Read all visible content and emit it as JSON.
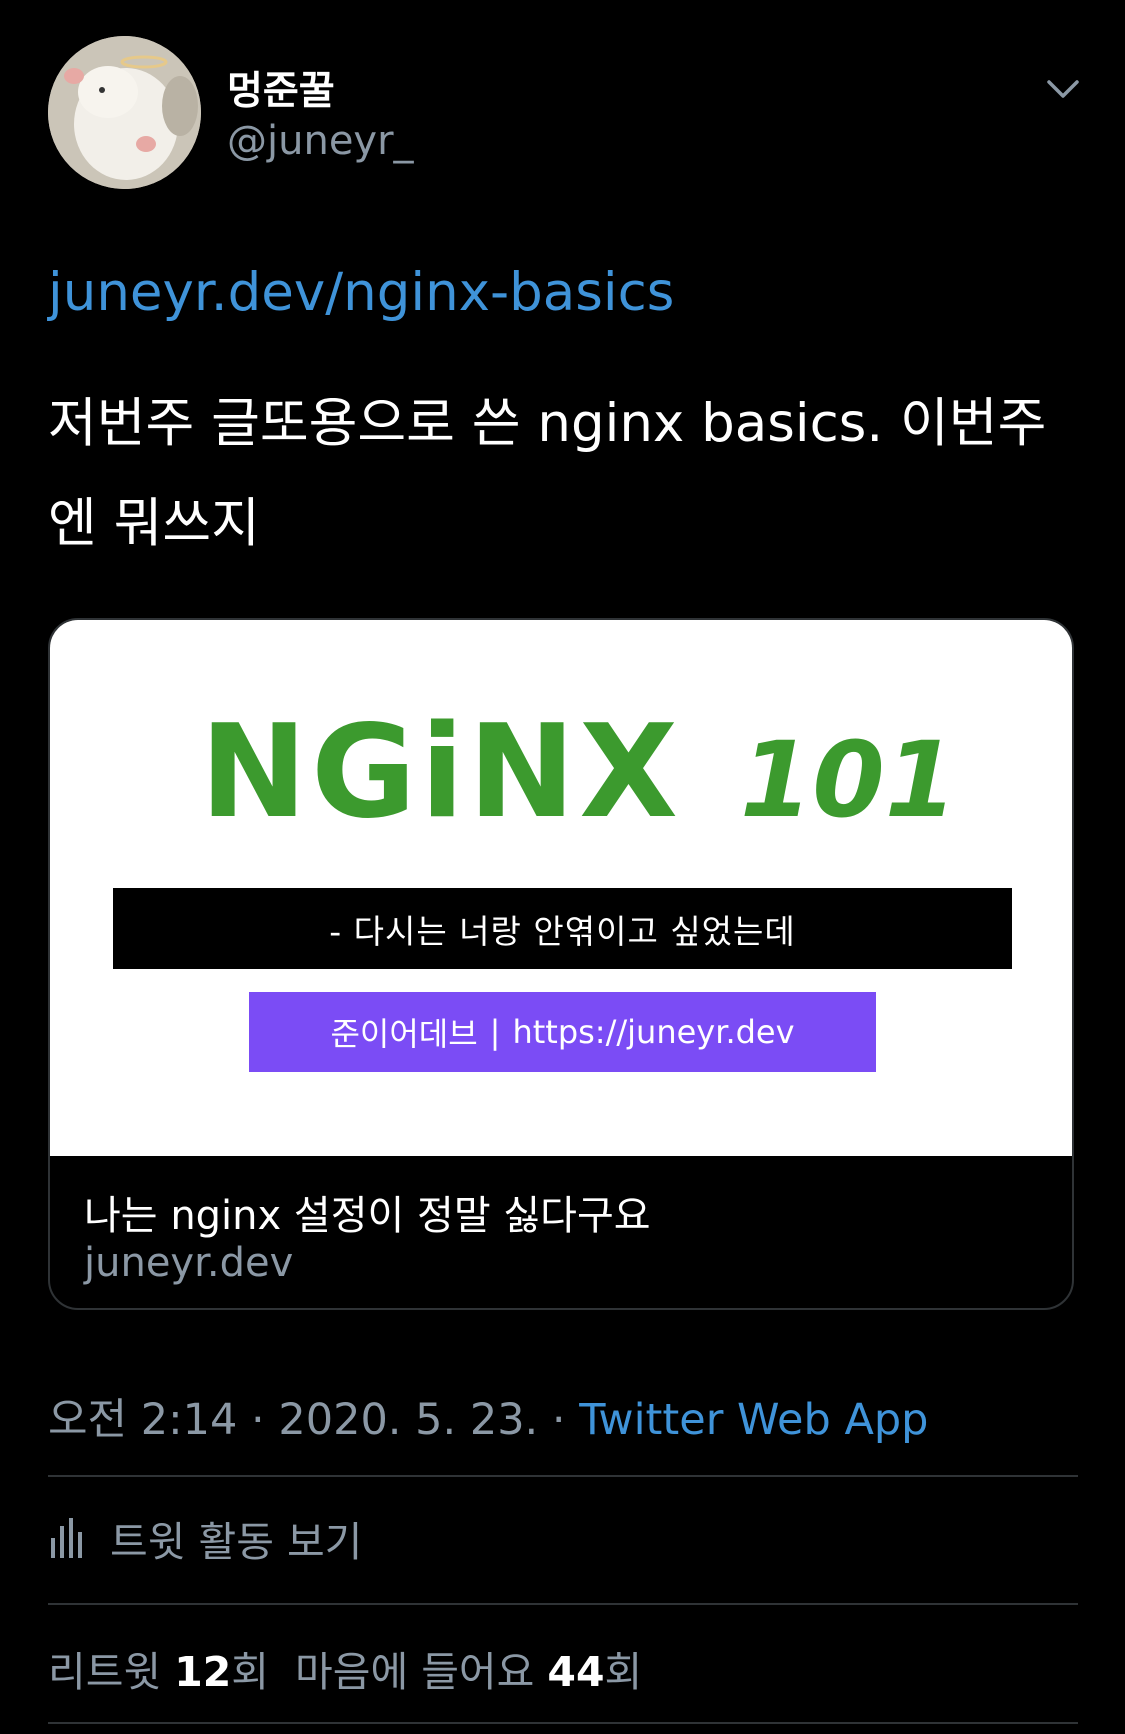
{
  "author": {
    "display_name": "멍준꿀",
    "handle": "@juneyr_"
  },
  "tweet": {
    "link": "juneyr.dev/nginx-basics",
    "text": "저번주 글또용으로 쓴 nginx basics. 이번주엔 뭐쓰지"
  },
  "card": {
    "image_logo_text": "NGiNX",
    "image_logo_number": "101",
    "image_subtitle": "- 다시는 너랑 안엮이고 싶었는데",
    "image_brand": "준이어데브",
    "image_separator": "|",
    "image_url": "https://juneyr.dev",
    "title": "나는 nginx 설정이 정말 싫다구요",
    "domain": "juneyr.dev"
  },
  "meta": {
    "time": "오전 2:14",
    "dot": "·",
    "date": "2020. 5. 23.",
    "source": "Twitter Web App"
  },
  "activity": {
    "label": "트윗 활동 보기"
  },
  "stats": {
    "retweets_label": "리트윗",
    "retweets_count": "12",
    "retweets_suffix": "회",
    "likes_label": "마음에 들어요",
    "likes_count": "44",
    "likes_suffix": "회"
  },
  "colors": {
    "background": "#000000",
    "link": "#3f93d9",
    "secondary_text": "#8b98a5",
    "divider": "#2f3336",
    "nginx_green": "#3c9a2e",
    "banner_purple": "#7b4cf5"
  },
  "icons": {
    "chevron": "chevron-down-icon",
    "activity": "bar-chart-icon"
  }
}
